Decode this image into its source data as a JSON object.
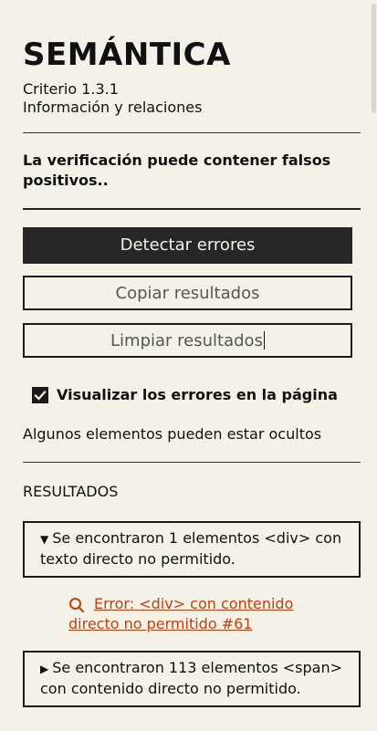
{
  "header": {
    "title": "SEMÁNTICA",
    "criterio": "Criterio 1.3.1",
    "subtitle": "Información y relaciones"
  },
  "warning": {
    "text": "La verificación puede contener falsos positivos.",
    "suffix": "."
  },
  "buttons": {
    "detect": "Detectar errores",
    "copy": "Copiar resultados",
    "clear": "Limpiar resultados"
  },
  "options": {
    "visualize_label": "Visualizar los errores en la página",
    "visualize_checked": true,
    "hint": "Algunos elementos pueden estar ocultos"
  },
  "results": {
    "title": "RESULTADOS",
    "groups": [
      {
        "expanded": true,
        "summary": "Se encontraron 1 elementos <div> con texto directo no permitido."
      },
      {
        "expanded": false,
        "summary": "Se encontraron 113 elementos <span> con contenido directo no permitido."
      }
    ],
    "error_link": "Error: <div> con contenido directo no permitido #61"
  },
  "colors": {
    "background": "#f4f1e8",
    "dark": "#262626",
    "link": "#c2400c"
  }
}
